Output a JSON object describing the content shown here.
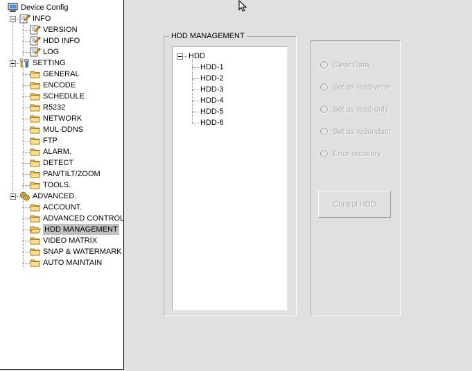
{
  "window": {
    "background_color": "#e0e0e0"
  },
  "tree": {
    "name": "device-config-tree",
    "selected_item": "HDD MANAGEMENT",
    "selection_color": "#c0c0c0",
    "items": [
      {
        "label": "Device Config",
        "level": 0,
        "icon": "computer-icon",
        "expander": "none"
      },
      {
        "label": "INFO",
        "level": 1,
        "icon": "document-pencil-icon",
        "expander": "minus"
      },
      {
        "label": "VERSION",
        "level": 2,
        "icon": "document-pencil-icon",
        "expander": "none"
      },
      {
        "label": "HDD INFO",
        "level": 2,
        "icon": "document-pencil-icon",
        "expander": "none"
      },
      {
        "label": "LOG",
        "level": 2,
        "icon": "document-pencil-icon",
        "expander": "none"
      },
      {
        "label": "SETTING",
        "level": 1,
        "icon": "tools-icon",
        "expander": "minus"
      },
      {
        "label": "GENERAL",
        "level": 2,
        "icon": "folder-icon",
        "expander": "none"
      },
      {
        "label": "ENCODE",
        "level": 2,
        "icon": "folder-icon",
        "expander": "none"
      },
      {
        "label": "SCHEDULE",
        "level": 2,
        "icon": "folder-icon",
        "expander": "none"
      },
      {
        "label": "R5232",
        "level": 2,
        "icon": "folder-icon",
        "expander": "none"
      },
      {
        "label": "NETWORK",
        "level": 2,
        "icon": "folder-icon",
        "expander": "none"
      },
      {
        "label": "MUL-DDNS",
        "level": 2,
        "icon": "folder-icon",
        "expander": "none"
      },
      {
        "label": "FTP",
        "level": 2,
        "icon": "folder-icon",
        "expander": "none"
      },
      {
        "label": "ALARM.",
        "level": 2,
        "icon": "folder-icon",
        "expander": "none"
      },
      {
        "label": "DETECT",
        "level": 2,
        "icon": "folder-icon",
        "expander": "none"
      },
      {
        "label": "PAN/TILT/ZOOM",
        "level": 2,
        "icon": "folder-icon",
        "expander": "none"
      },
      {
        "label": "TOOLS.",
        "level": 2,
        "icon": "folder-icon",
        "expander": "none"
      },
      {
        "label": "ADVANCED.",
        "level": 1,
        "icon": "gears-icon",
        "expander": "minus"
      },
      {
        "label": "ACCOUNT.",
        "level": 2,
        "icon": "folder-icon",
        "expander": "none"
      },
      {
        "label": "ADVANCED CONTROL.",
        "level": 2,
        "icon": "folder-icon",
        "expander": "none"
      },
      {
        "label": "HDD MANAGEMENT",
        "level": 2,
        "icon": "folder-open-icon",
        "expander": "none",
        "selected": true
      },
      {
        "label": "VIDEO MATRIX",
        "level": 2,
        "icon": "folder-icon",
        "expander": "none"
      },
      {
        "label": "SNAP & WATERMARK",
        "level": 2,
        "icon": "folder-icon",
        "expander": "none"
      },
      {
        "label": "AUTO MAINTAIN",
        "level": 2,
        "icon": "folder-icon",
        "expander": "none"
      }
    ]
  },
  "hdd_management": {
    "group_title": "HDD MANAGEMENT",
    "list": {
      "root": {
        "label": "HDD",
        "expander": "minus"
      },
      "items": [
        {
          "label": "HDD-1"
        },
        {
          "label": "HDD-2"
        },
        {
          "label": "HDD-3"
        },
        {
          "label": "HDD-4"
        },
        {
          "label": "HDD-5"
        },
        {
          "label": "HDD-6"
        }
      ]
    }
  },
  "actions_panel": {
    "radios": [
      {
        "label": "Clear Data",
        "checked": false,
        "disabled": true
      },
      {
        "label": "Set as read-write",
        "checked": false,
        "disabled": true
      },
      {
        "label": "Set as read-only",
        "checked": false,
        "disabled": true
      },
      {
        "label": "Set as redundant",
        "checked": false,
        "disabled": true
      },
      {
        "label": "Error recovery",
        "checked": false,
        "disabled": true
      }
    ],
    "button": {
      "label": "Control HDD",
      "disabled": true
    }
  }
}
